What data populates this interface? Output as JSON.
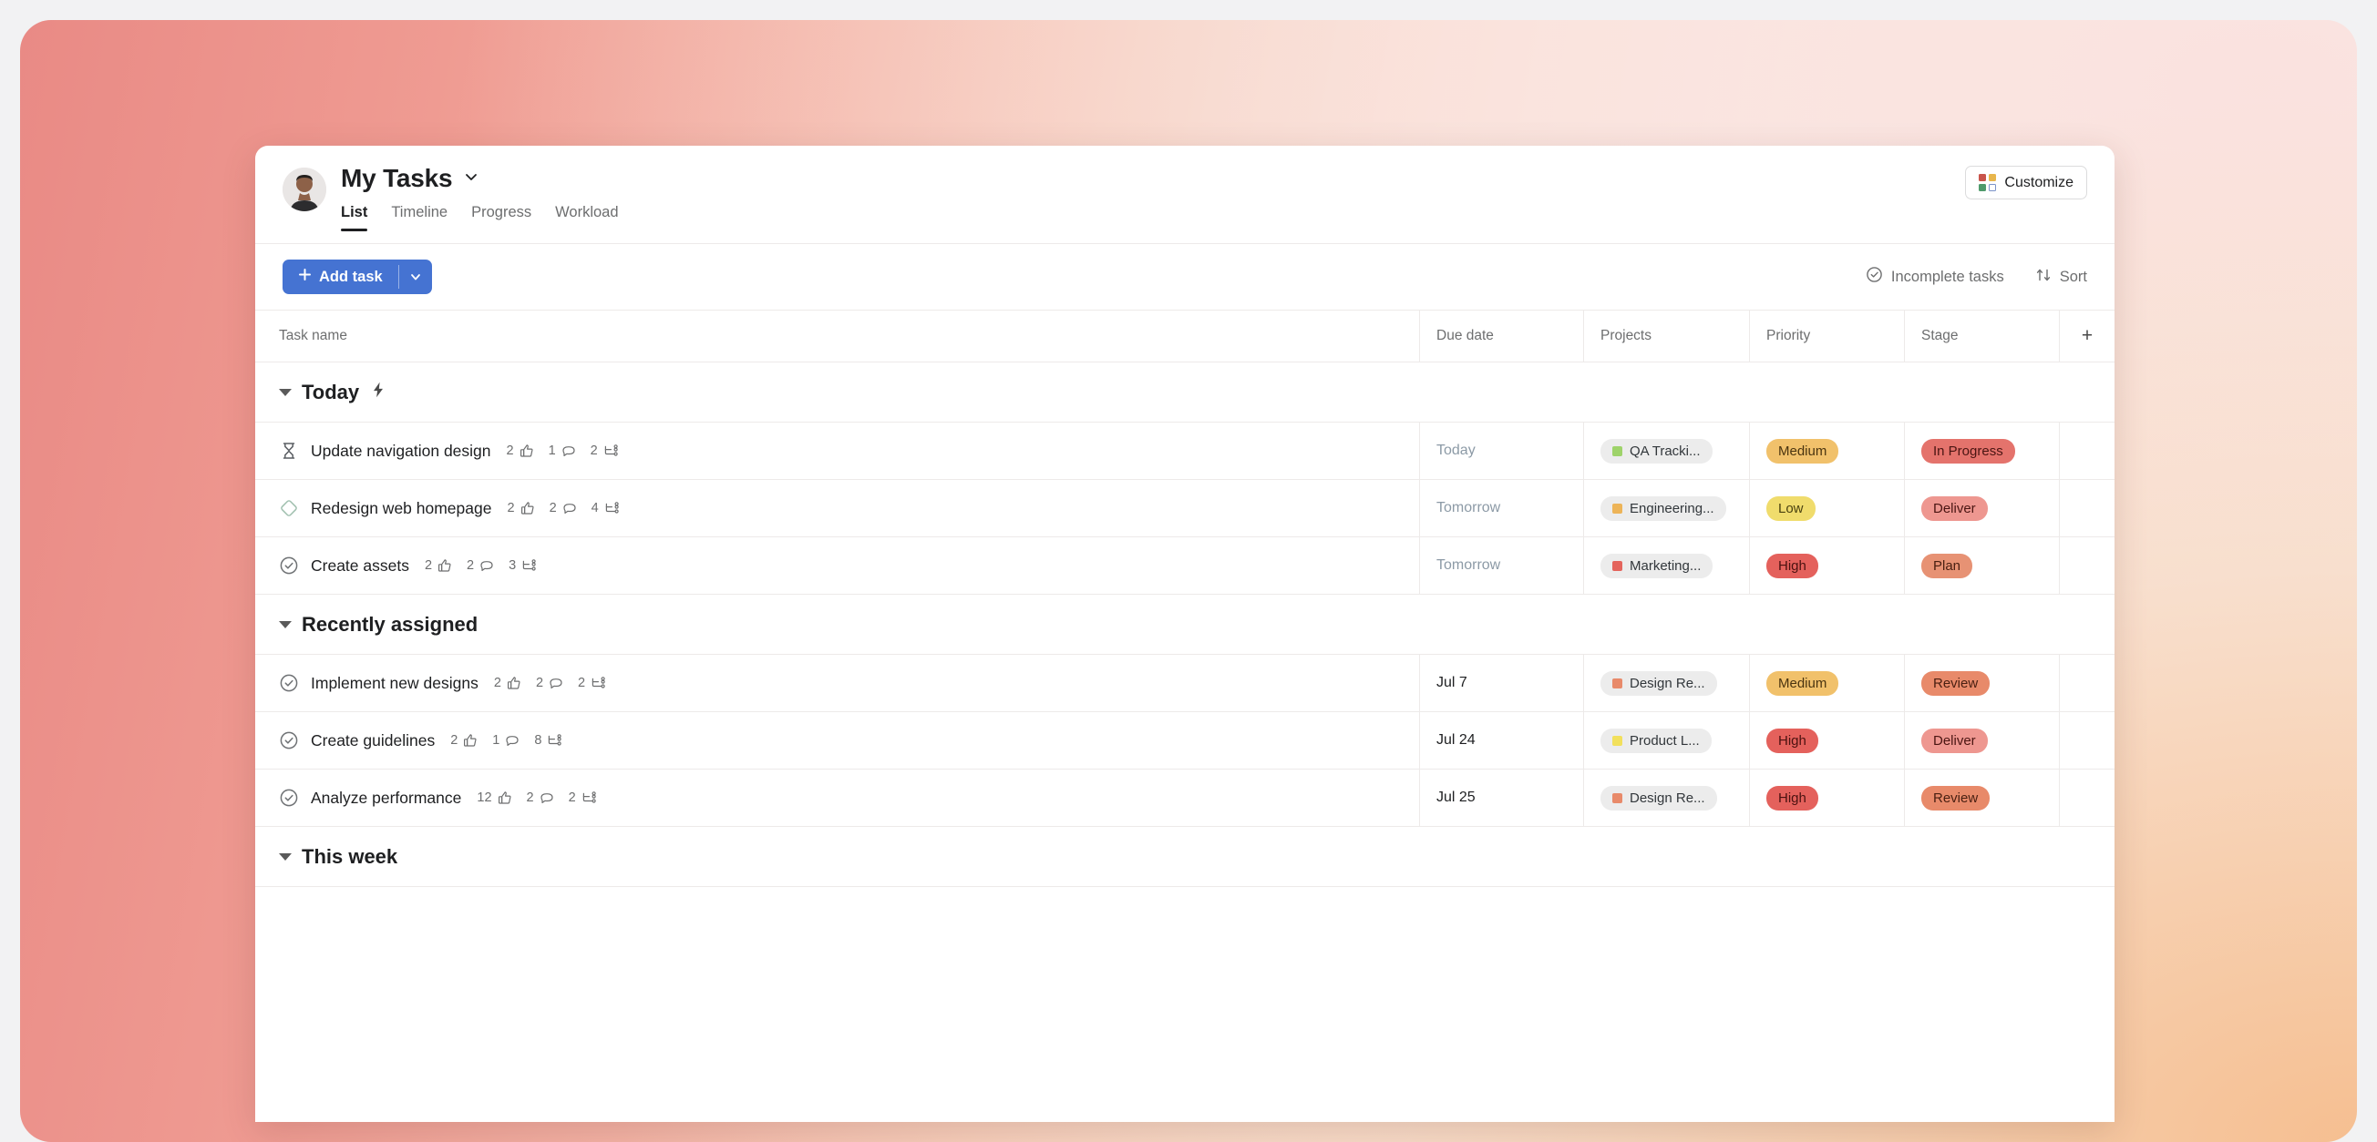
{
  "theme": {
    "accent_blue": "#4573D2",
    "backdrop_from": "#E98A85",
    "backdrop_to": "#FBF0EA",
    "card_bg": "#FFFFFF"
  },
  "header": {
    "avatar_name": "user-avatar",
    "title": "My Tasks",
    "title_caret_icon": "chevron-down-icon",
    "tabs": [
      {
        "label": "List",
        "active": true
      },
      {
        "label": "Timeline",
        "active": false
      },
      {
        "label": "Progress",
        "active": false
      },
      {
        "label": "Workload",
        "active": false
      }
    ],
    "customize": {
      "label": "Customize",
      "icon": "four-squares-icon",
      "swatch_colors": [
        "#C9544B",
        "#E8B64C",
        "#4E9A6B",
        "#FFFFFF"
      ]
    }
  },
  "toolbar": {
    "add_task_label": "Add task",
    "add_task_plus_icon": "plus-icon",
    "add_task_caret_icon": "chevron-down-icon",
    "incomplete_tasks_label": "Incomplete tasks",
    "incomplete_tasks_icon": "check-circle-icon",
    "sort_label": "Sort",
    "sort_icon": "sort-arrows-icon"
  },
  "table": {
    "columns": [
      {
        "key": "name",
        "label": "Task name"
      },
      {
        "key": "due",
        "label": "Due date"
      },
      {
        "key": "proj",
        "label": "Projects"
      },
      {
        "key": "prio",
        "label": "Priority"
      },
      {
        "key": "stage",
        "label": "Stage"
      }
    ],
    "add_column_icon": "plus-icon",
    "add_column_label": "+"
  },
  "sections": [
    {
      "title": "Today",
      "badge_icon": "lightning-bolt-icon",
      "collapse_icon": "caret-down-icon",
      "rows": [
        {
          "status_icon": "hourglass-icon",
          "status_icon_color": "#5a5e63",
          "name": "Update navigation design",
          "likes": "2",
          "comments": "1",
          "subtasks": "2",
          "due": "Today",
          "due_style": "soft",
          "project": "QA Tracki...",
          "project_color": "#9ED36A",
          "priority": "Medium",
          "priority_bg": "#F1C16B",
          "priority_fg": "#4a3410",
          "stage": "In Progress",
          "stage_bg": "#E4736C",
          "stage_fg": "#4a1512"
        },
        {
          "status_icon": "diamond-icon",
          "status_icon_color": "#9fbfae",
          "name": "Redesign web homepage",
          "likes": "2",
          "comments": "2",
          "subtasks": "4",
          "due": "Tomorrow",
          "due_style": "soft",
          "project": "Engineering...",
          "project_color": "#EDB458",
          "priority": "Low",
          "priority_bg": "#F0DC6C",
          "priority_fg": "#4a4210",
          "stage": "Deliver",
          "stage_bg": "#EE9790",
          "stage_fg": "#4a1512"
        },
        {
          "status_icon": "check-circle-icon",
          "status_icon_color": "#6f7275",
          "name": "Create assets",
          "likes": "2",
          "comments": "2",
          "subtasks": "3",
          "due": "Tomorrow",
          "due_style": "soft",
          "project": "Marketing...",
          "project_color": "#E4645C",
          "priority": "High",
          "priority_bg": "#E4615C",
          "priority_fg": "#4a1210",
          "stage": "Plan",
          "stage_bg": "#E79274",
          "stage_fg": "#4a2012"
        }
      ]
    },
    {
      "title": "Recently assigned",
      "badge_icon": "",
      "collapse_icon": "caret-down-icon",
      "rows": [
        {
          "status_icon": "check-circle-icon",
          "status_icon_color": "#6f7275",
          "name": "Implement new designs",
          "likes": "2",
          "comments": "2",
          "subtasks": "2",
          "due": "Jul 7",
          "due_style": "hard",
          "project": "Design Re...",
          "project_color": "#E88A6A",
          "priority": "Medium",
          "priority_bg": "#F1C16B",
          "priority_fg": "#4a3410",
          "stage": "Review",
          "stage_bg": "#E88A6A",
          "stage_fg": "#4a2012"
        },
        {
          "status_icon": "check-circle-icon",
          "status_icon_color": "#6f7275",
          "name": "Create guidelines",
          "likes": "2",
          "comments": "1",
          "subtasks": "8",
          "due": "Jul 24",
          "due_style": "hard",
          "project": "Product L...",
          "project_color": "#F2E05C",
          "priority": "High",
          "priority_bg": "#E4615C",
          "priority_fg": "#4a1210",
          "stage": "Deliver",
          "stage_bg": "#EE9790",
          "stage_fg": "#4a1512"
        },
        {
          "status_icon": "check-circle-icon",
          "status_icon_color": "#6f7275",
          "name": "Analyze performance",
          "likes": "12",
          "comments": "2",
          "subtasks": "2",
          "due": "Jul 25",
          "due_style": "hard",
          "project": "Design Re...",
          "project_color": "#E88A6A",
          "priority": "High",
          "priority_bg": "#E4615C",
          "priority_fg": "#4a1210",
          "stage": "Review",
          "stage_bg": "#E88A6A",
          "stage_fg": "#4a2012"
        }
      ]
    },
    {
      "title": "This week",
      "badge_icon": "",
      "collapse_icon": "caret-down-icon",
      "rows": []
    }
  ]
}
